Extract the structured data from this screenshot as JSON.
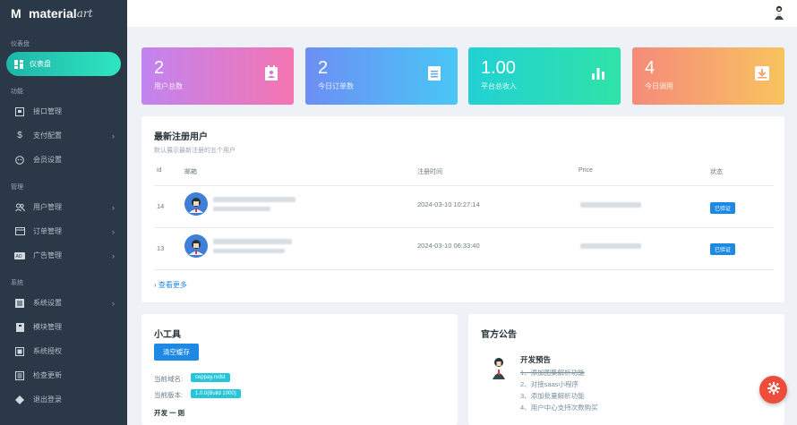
{
  "brand": {
    "logo": "M",
    "name": "material",
    "suffix": "art"
  },
  "sidebar": {
    "sections": [
      {
        "label": "仪表盘"
      },
      {
        "label": "功能"
      },
      {
        "label": "管理"
      },
      {
        "label": "系统"
      }
    ],
    "active_item": {
      "label": "仪表盘",
      "icon": "dashboard-icon"
    },
    "items": [
      {
        "label": "接口管理",
        "icon": "api-icon"
      },
      {
        "label": "支付配置",
        "icon": "dollar-icon"
      },
      {
        "label": "会员设置",
        "icon": "member-icon"
      },
      {
        "label": "用户管理",
        "icon": "users-icon"
      },
      {
        "label": "订单管理",
        "icon": "order-icon"
      },
      {
        "label": "广告管理",
        "icon": "ad-icon"
      },
      {
        "label": "系统设置",
        "icon": "settings-icon"
      },
      {
        "label": "模块管理",
        "icon": "module-icon"
      },
      {
        "label": "系统授权",
        "icon": "license-icon"
      },
      {
        "label": "检查更新",
        "icon": "update-icon"
      },
      {
        "label": "退出登录",
        "icon": "logout-icon"
      }
    ]
  },
  "stats": [
    {
      "value": "2",
      "label": "用户总数",
      "icon": "contact-icon"
    },
    {
      "value": "2",
      "label": "今日订单数",
      "icon": "document-icon"
    },
    {
      "value": "1.00",
      "label": "平台总收入",
      "icon": "bar-chart-icon"
    },
    {
      "value": "4",
      "label": "今日调用",
      "icon": "download-icon"
    }
  ],
  "users_panel": {
    "title": "最新注册用户",
    "subtitle": "默认展示最新注册的五个用户",
    "columns": [
      "id",
      "邮箱",
      "注册时间",
      "Price",
      "状态"
    ],
    "rows": [
      {
        "id": "14",
        "time": "2024-03-10 10:27:14",
        "status": "已验证"
      },
      {
        "id": "13",
        "time": "2024-03-10 06:33:40",
        "status": "已验证"
      }
    ],
    "more": "查看更多"
  },
  "tools_panel": {
    "title": "小工具",
    "clear_button": "清空缓存",
    "domain_label": "当前域名:",
    "domain_value": "ceppay.rvdst",
    "version_label": "当前版本:",
    "version_value": "1.0.0(Build 1000)",
    "extra": "开发 一 则"
  },
  "notice_panel": {
    "title": "官方公告",
    "heading": "开发预告",
    "items": [
      "1、添加图集解析功能",
      "2、对接saas小程序",
      "3、添加批量解析功能",
      "4、用户中心支持次数购买"
    ]
  },
  "colors": {
    "sidebar_bg": "#2b3848",
    "active_gradient": [
      "#1fb5a8",
      "#2ee6c0"
    ],
    "card1": [
      "#c184f0",
      "#f575b2"
    ],
    "card2": [
      "#6d8ef5",
      "#49c7f5"
    ],
    "card3": [
      "#22d1d4",
      "#2fe3a8"
    ],
    "card4": [
      "#f58b7a",
      "#f8c35f"
    ],
    "badge": "#1e88e5",
    "fab": "#ef4d3b"
  }
}
